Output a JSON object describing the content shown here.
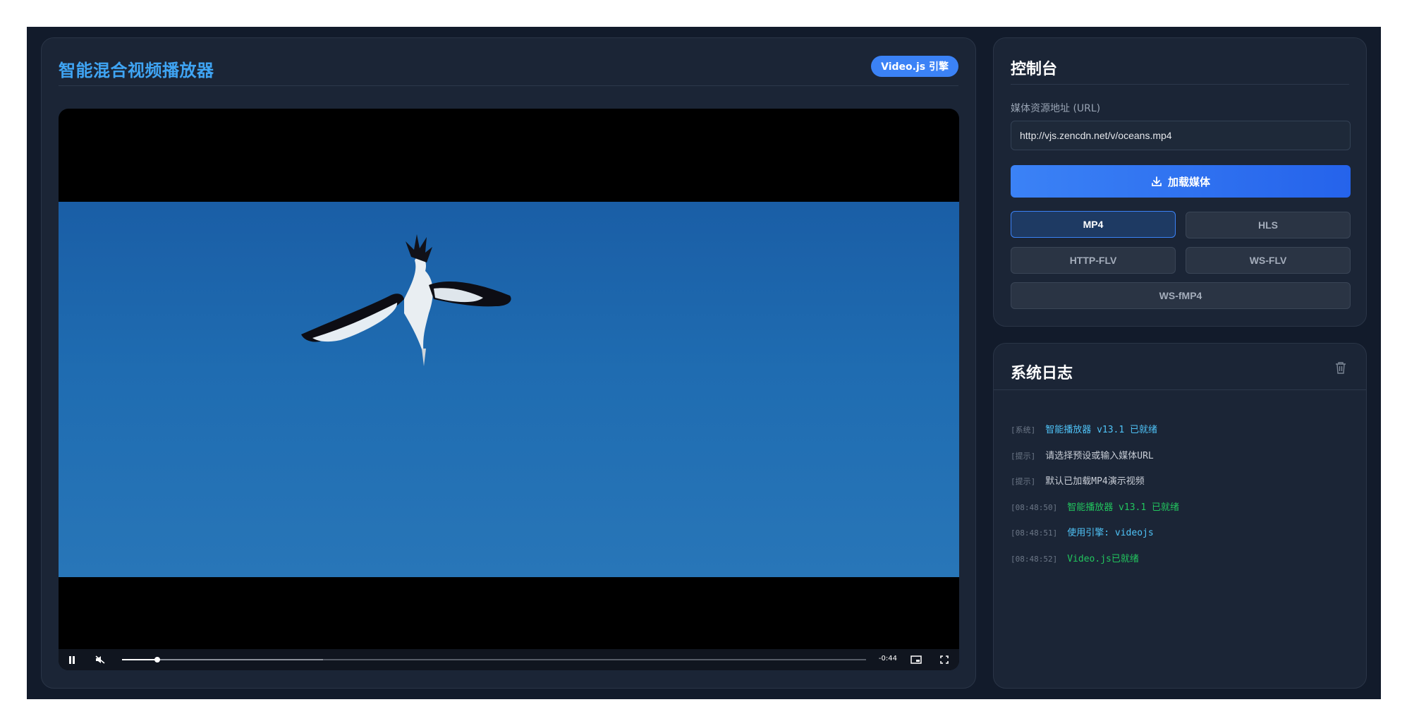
{
  "player": {
    "title": "智能混合视频播放器",
    "engine_badge": "Video.js 引擎",
    "time_remaining": "-0:44",
    "progress": {
      "played": 0.047,
      "buffered": 0.27
    }
  },
  "control": {
    "title": "控制台",
    "url_label": "媒体资源地址 (URL)",
    "url_value": "http://vjs.zencdn.net/v/oceans.mp4",
    "load_label": "加载媒体",
    "formats": [
      {
        "label": "MP4",
        "active": true
      },
      {
        "label": "HLS",
        "active": false
      },
      {
        "label": "HTTP-FLV",
        "active": false
      },
      {
        "label": "WS-FLV",
        "active": false
      },
      {
        "label": "WS-fMP4",
        "active": false
      }
    ]
  },
  "log": {
    "title": "系统日志",
    "entries": [
      {
        "tag": "[系统]",
        "text": "智能播放器 v13.1 已就绪",
        "color": "#4fc3f7"
      },
      {
        "tag": "[提示]",
        "text": "请选择预设或输入媒体URL",
        "color": "#c8cdd6"
      },
      {
        "tag": "[提示]",
        "text": "默认已加载MP4演示视频",
        "color": "#c8cdd6"
      },
      {
        "tag": "[08:48:50]",
        "text": "智能播放器 v13.1 已就绪",
        "color": "#22c55e"
      },
      {
        "tag": "[08:48:51]",
        "text": "使用引擎: videojs",
        "color": "#4fc3f7"
      },
      {
        "tag": "[08:48:52]",
        "text": "Video.js已就绪",
        "color": "#22c55e"
      }
    ]
  },
  "colors": {
    "accent": "#3b82f6",
    "title": "#3fa4f3",
    "success": "#22c55e",
    "info": "#4fc3f7"
  }
}
